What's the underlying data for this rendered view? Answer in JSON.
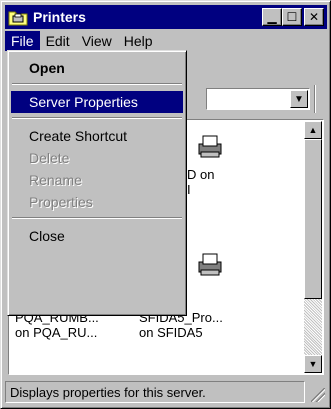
{
  "window": {
    "title": "Printers"
  },
  "menubar": {
    "file": "File",
    "edit": "Edit",
    "view": "View",
    "help": "Help"
  },
  "file_menu": {
    "open": "Open",
    "server_properties": "Server Properties",
    "create_shortcut": "Create Shortcut",
    "delete": "Delete",
    "rename": "Rename",
    "properties": "Properties",
    "close": "Close"
  },
  "listview": {
    "fragment_1": "D on",
    "fragment_2": "I",
    "item1_line1": "PQA_RUMB...",
    "item1_line2": "on PQA_RU...",
    "item2_line1": "SFIDA5_Pro...",
    "item2_line2": "on SFIDA5"
  },
  "statusbar": {
    "text": "Displays properties for this server."
  },
  "colors": {
    "titlebar": "#000080",
    "face": "#c0c0c0",
    "selection": "#000080"
  }
}
